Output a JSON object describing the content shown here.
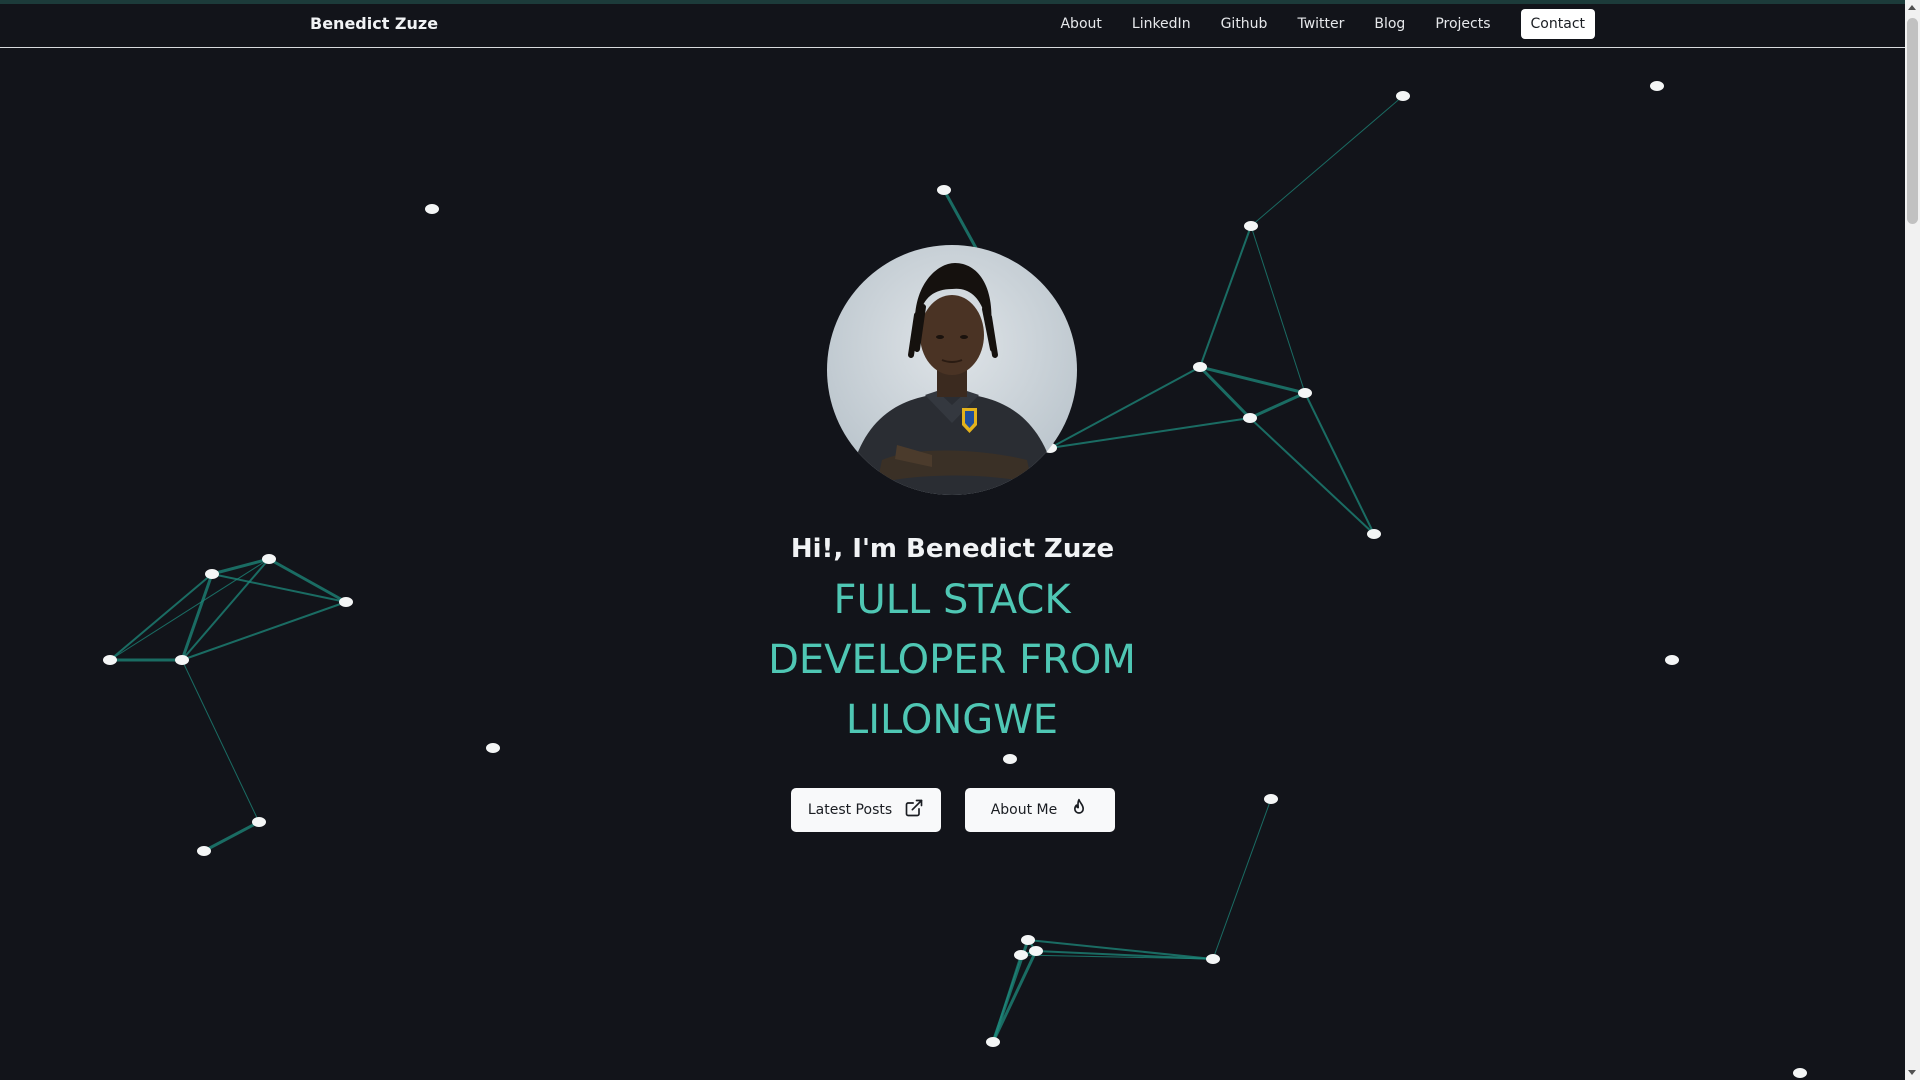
{
  "navbar": {
    "brand": "Benedict Zuze",
    "links": [
      "About",
      "LinkedIn",
      "Github",
      "Twitter",
      "Blog",
      "Projects"
    ],
    "contact_label": "Contact"
  },
  "hero": {
    "greeting": "Hi!, I'm Benedict Zuze",
    "role_lines": [
      "FULL STACK",
      "DEVELOPER FROM",
      "LILONGWE"
    ],
    "buttons": {
      "latest_posts": "Latest Posts",
      "about_me": "About Me"
    }
  },
  "colors": {
    "background": "#12141a",
    "accent": "#4fc7b4",
    "network_line": "#1e8a7c"
  },
  "icons": {
    "latest_posts": "external-link-icon",
    "about_me": "flame-icon"
  }
}
